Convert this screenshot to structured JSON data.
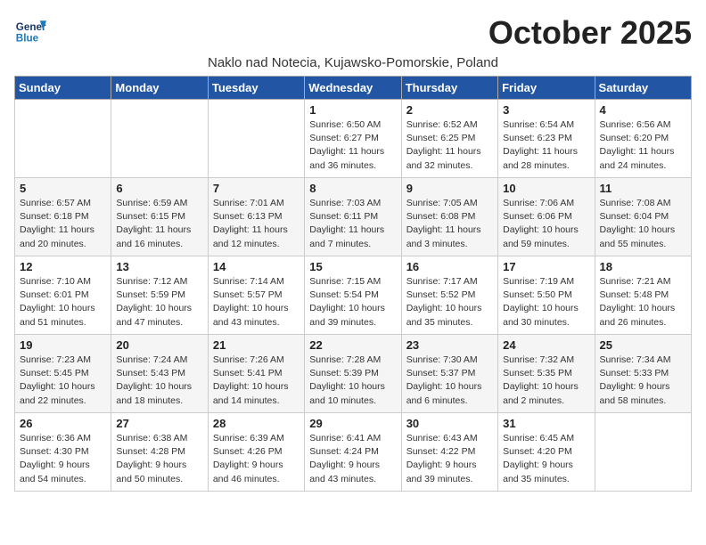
{
  "logo": {
    "general": "General",
    "blue": "Blue"
  },
  "title": "October 2025",
  "subtitle": "Naklo nad Notecia, Kujawsko-Pomorskie, Poland",
  "days_header": [
    "Sunday",
    "Monday",
    "Tuesday",
    "Wednesday",
    "Thursday",
    "Friday",
    "Saturday"
  ],
  "weeks": [
    [
      {
        "day": "",
        "content": ""
      },
      {
        "day": "",
        "content": ""
      },
      {
        "day": "",
        "content": ""
      },
      {
        "day": "1",
        "content": "Sunrise: 6:50 AM\nSunset: 6:27 PM\nDaylight: 11 hours\nand 36 minutes."
      },
      {
        "day": "2",
        "content": "Sunrise: 6:52 AM\nSunset: 6:25 PM\nDaylight: 11 hours\nand 32 minutes."
      },
      {
        "day": "3",
        "content": "Sunrise: 6:54 AM\nSunset: 6:23 PM\nDaylight: 11 hours\nand 28 minutes."
      },
      {
        "day": "4",
        "content": "Sunrise: 6:56 AM\nSunset: 6:20 PM\nDaylight: 11 hours\nand 24 minutes."
      }
    ],
    [
      {
        "day": "5",
        "content": "Sunrise: 6:57 AM\nSunset: 6:18 PM\nDaylight: 11 hours\nand 20 minutes."
      },
      {
        "day": "6",
        "content": "Sunrise: 6:59 AM\nSunset: 6:15 PM\nDaylight: 11 hours\nand 16 minutes."
      },
      {
        "day": "7",
        "content": "Sunrise: 7:01 AM\nSunset: 6:13 PM\nDaylight: 11 hours\nand 12 minutes."
      },
      {
        "day": "8",
        "content": "Sunrise: 7:03 AM\nSunset: 6:11 PM\nDaylight: 11 hours\nand 7 minutes."
      },
      {
        "day": "9",
        "content": "Sunrise: 7:05 AM\nSunset: 6:08 PM\nDaylight: 11 hours\nand 3 minutes."
      },
      {
        "day": "10",
        "content": "Sunrise: 7:06 AM\nSunset: 6:06 PM\nDaylight: 10 hours\nand 59 minutes."
      },
      {
        "day": "11",
        "content": "Sunrise: 7:08 AM\nSunset: 6:04 PM\nDaylight: 10 hours\nand 55 minutes."
      }
    ],
    [
      {
        "day": "12",
        "content": "Sunrise: 7:10 AM\nSunset: 6:01 PM\nDaylight: 10 hours\nand 51 minutes."
      },
      {
        "day": "13",
        "content": "Sunrise: 7:12 AM\nSunset: 5:59 PM\nDaylight: 10 hours\nand 47 minutes."
      },
      {
        "day": "14",
        "content": "Sunrise: 7:14 AM\nSunset: 5:57 PM\nDaylight: 10 hours\nand 43 minutes."
      },
      {
        "day": "15",
        "content": "Sunrise: 7:15 AM\nSunset: 5:54 PM\nDaylight: 10 hours\nand 39 minutes."
      },
      {
        "day": "16",
        "content": "Sunrise: 7:17 AM\nSunset: 5:52 PM\nDaylight: 10 hours\nand 35 minutes."
      },
      {
        "day": "17",
        "content": "Sunrise: 7:19 AM\nSunset: 5:50 PM\nDaylight: 10 hours\nand 30 minutes."
      },
      {
        "day": "18",
        "content": "Sunrise: 7:21 AM\nSunset: 5:48 PM\nDaylight: 10 hours\nand 26 minutes."
      }
    ],
    [
      {
        "day": "19",
        "content": "Sunrise: 7:23 AM\nSunset: 5:45 PM\nDaylight: 10 hours\nand 22 minutes."
      },
      {
        "day": "20",
        "content": "Sunrise: 7:24 AM\nSunset: 5:43 PM\nDaylight: 10 hours\nand 18 minutes."
      },
      {
        "day": "21",
        "content": "Sunrise: 7:26 AM\nSunset: 5:41 PM\nDaylight: 10 hours\nand 14 minutes."
      },
      {
        "day": "22",
        "content": "Sunrise: 7:28 AM\nSunset: 5:39 PM\nDaylight: 10 hours\nand 10 minutes."
      },
      {
        "day": "23",
        "content": "Sunrise: 7:30 AM\nSunset: 5:37 PM\nDaylight: 10 hours\nand 6 minutes."
      },
      {
        "day": "24",
        "content": "Sunrise: 7:32 AM\nSunset: 5:35 PM\nDaylight: 10 hours\nand 2 minutes."
      },
      {
        "day": "25",
        "content": "Sunrise: 7:34 AM\nSunset: 5:33 PM\nDaylight: 9 hours\nand 58 minutes."
      }
    ],
    [
      {
        "day": "26",
        "content": "Sunrise: 6:36 AM\nSunset: 4:30 PM\nDaylight: 9 hours\nand 54 minutes."
      },
      {
        "day": "27",
        "content": "Sunrise: 6:38 AM\nSunset: 4:28 PM\nDaylight: 9 hours\nand 50 minutes."
      },
      {
        "day": "28",
        "content": "Sunrise: 6:39 AM\nSunset: 4:26 PM\nDaylight: 9 hours\nand 46 minutes."
      },
      {
        "day": "29",
        "content": "Sunrise: 6:41 AM\nSunset: 4:24 PM\nDaylight: 9 hours\nand 43 minutes."
      },
      {
        "day": "30",
        "content": "Sunrise: 6:43 AM\nSunset: 4:22 PM\nDaylight: 9 hours\nand 39 minutes."
      },
      {
        "day": "31",
        "content": "Sunrise: 6:45 AM\nSunset: 4:20 PM\nDaylight: 9 hours\nand 35 minutes."
      },
      {
        "day": "",
        "content": ""
      }
    ]
  ]
}
